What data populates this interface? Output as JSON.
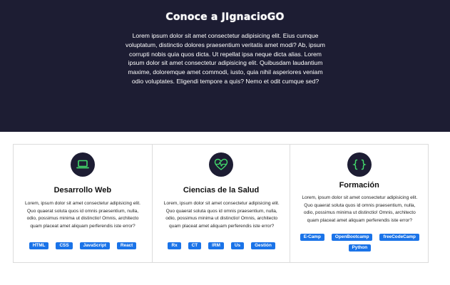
{
  "hero": {
    "title": "Conoce a JIgnacioGO",
    "text": "Lorem ipsum dolor sit amet consectetur adipisicing elit. Eius cumque voluptatum, distinctio dolores praesentium veritatis amet modi? Ab, ipsum corrupti nobis quia quos dicta. Ut repellat ipsa neque dicta alias. Lorem ipsum dolor sit amet consectetur adipisicing elit. Quibusdam laudantium maxime, doloremque amet commodi, iusto, quia nihil asperiores veniam odio voluptates. Eligendi tempore a quis? Nemo et odit cumque sed?"
  },
  "cards": [
    {
      "icon": "laptop-icon",
      "title": "Desarrollo Web",
      "text": "Lorem, ipsum dolor sit amet consectetur adipisicing elit. Quo quaerat soluta quos id omnis praesentium, nulla, odio, possimus minima ut distinctio! Omnis, architecto quam placeat amet aliquam perferendis iste error?",
      "tags": [
        "HTML",
        "CSS",
        "JavaScript",
        "React"
      ]
    },
    {
      "icon": "heart-pulse-icon",
      "title": "Ciencias de la Salud",
      "text": "Lorem, ipsum dolor sit amet consectetur adipisicing elit. Quo quaerat soluta quos id omnis praesentium, nulla, odio, possimus minima ut distinctio! Omnis, architecto quam placeat amet aliquam perferendis iste error?",
      "tags": [
        "Rx",
        "CT",
        "IRM",
        "Us",
        "Gestión"
      ]
    },
    {
      "icon": "code-braces-icon",
      "title": "Formación",
      "text": "Lorem, ipsum dolor sit amet consectetur adipisicing elit. Quo quaerat soluta quos id omnis praesentium, nulla, odio, possimus minima ut distinctio! Omnis, architecto quam placeat amet aliquam perferendis iste error?",
      "tags": [
        "E-Camp",
        "OpenBootcamp",
        "freeCodeCamp",
        "Python"
      ]
    }
  ],
  "colors": {
    "hero_bg": "#1d1d33",
    "icon_bg": "#1d1d33",
    "icon_fg": "#42d96b",
    "badge_bg": "#1a73e8"
  }
}
